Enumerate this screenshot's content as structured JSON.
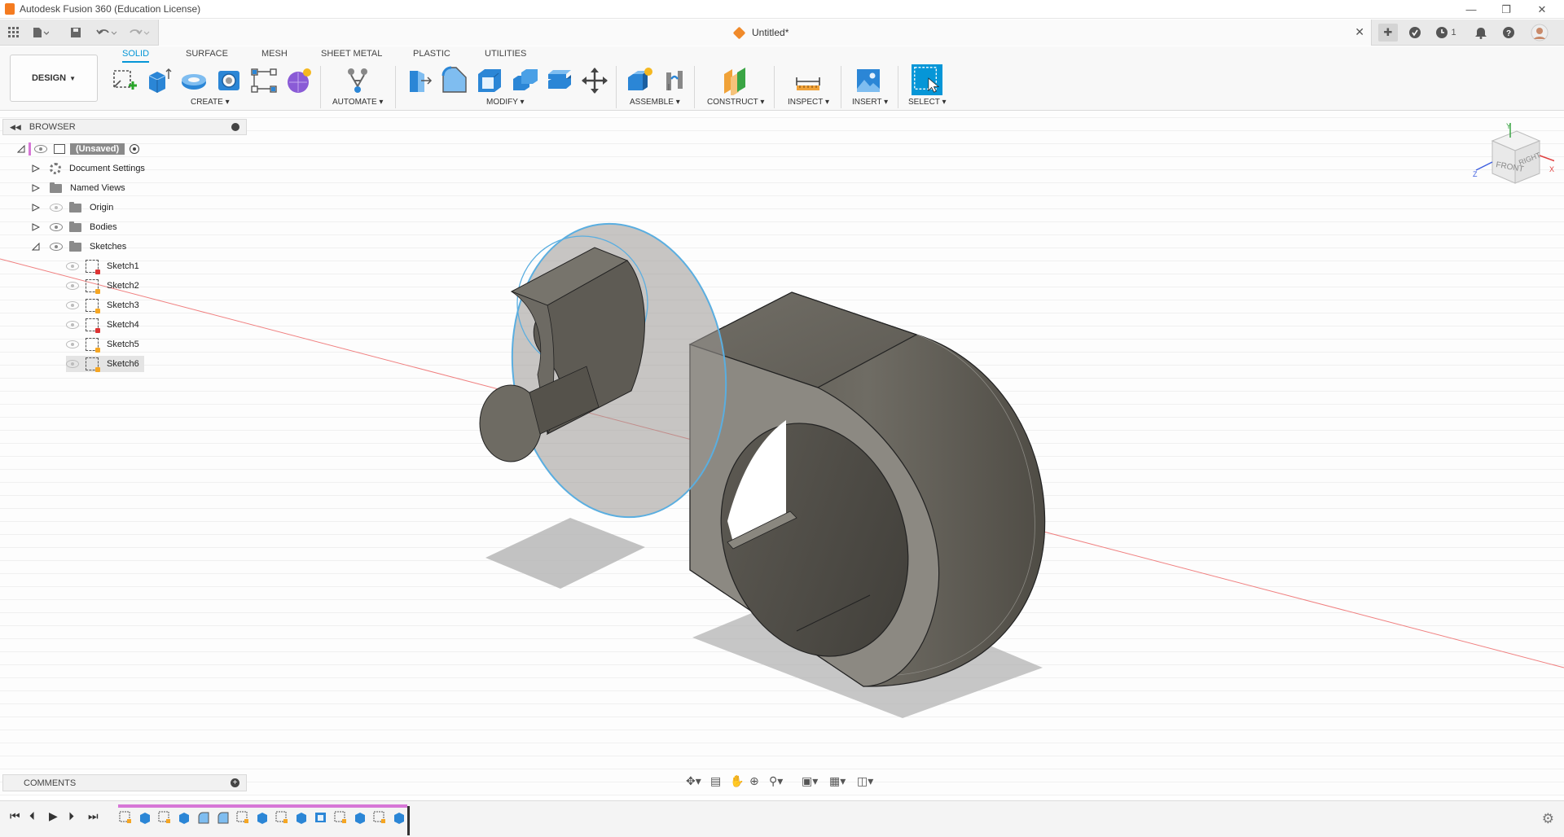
{
  "window": {
    "title": "Autodesk Fusion 360 (Education License)"
  },
  "document": {
    "title": "Untitled*"
  },
  "toolbar": {
    "workspace": "DESIGN",
    "tabs": [
      "SOLID",
      "SURFACE",
      "MESH",
      "SHEET METAL",
      "PLASTIC",
      "UTILITIES"
    ],
    "groups": [
      "CREATE",
      "AUTOMATE",
      "MODIFY",
      "ASSEMBLE",
      "CONSTRUCT",
      "INSPECT",
      "INSERT",
      "SELECT"
    ]
  },
  "header_right": {
    "job_count": "1"
  },
  "browser": {
    "title": "BROWSER",
    "root": "(Unsaved)",
    "items": [
      "Document Settings",
      "Named Views",
      "Origin",
      "Bodies",
      "Sketches"
    ],
    "sketches": [
      "Sketch1",
      "Sketch2",
      "Sketch3",
      "Sketch4",
      "Sketch5",
      "Sketch6"
    ]
  },
  "comments": {
    "title": "COMMENTS"
  },
  "viewcube": {
    "front": "FRONT",
    "right": "RIGHT",
    "x": "X",
    "y": "Y",
    "z": "Z"
  },
  "colors": {
    "accent": "#0696d7",
    "select": "#0696d7",
    "timeline": "#d777d7",
    "body": "#6a675f"
  }
}
